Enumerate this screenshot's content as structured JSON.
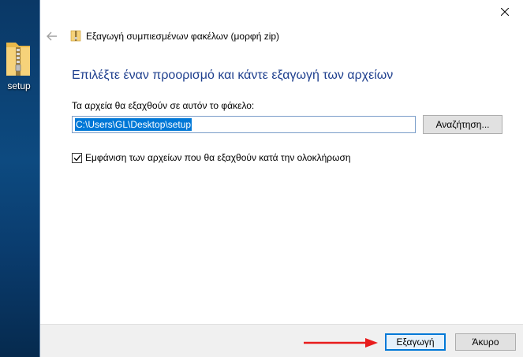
{
  "desktop": {
    "icon_label": "setup"
  },
  "window": {
    "nav_title": "Εξαγωγή συμπιεσμένων φακέλων (μορφή zip)",
    "heading": "Επιλέξτε έναν προορισμό και κάντε εξαγωγή των αρχείων",
    "dest_label": "Τα αρχεία θα εξαχθούν σε αυτόν το φάκελο:",
    "path_value": "C:\\Users\\GL\\Desktop\\setup",
    "browse_label": "Αναζήτηση...",
    "checkbox_label": "Εμφάνιση των αρχείων που θα εξαχθούν κατά την ολοκλήρωση",
    "checkbox_checked": true
  },
  "footer": {
    "extract_label": "Εξαγωγή",
    "cancel_label": "Άκυρο"
  },
  "colors": {
    "heading": "#1e3f8e",
    "accent": "#0078d7",
    "annotation_arrow": "#e81c1c"
  }
}
